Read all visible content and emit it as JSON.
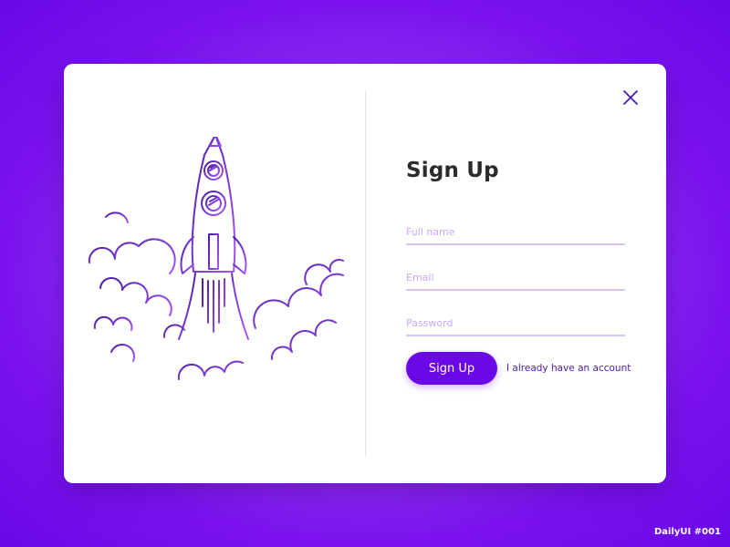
{
  "form": {
    "title": "Sign Up",
    "fields": [
      {
        "placeholder": "Full name",
        "value": ""
      },
      {
        "placeholder": "Email",
        "value": ""
      },
      {
        "placeholder": "Password",
        "value": ""
      }
    ],
    "submit_label": "Sign Up",
    "login_link": "I already have an account"
  },
  "credit": "DailyUI #001",
  "icons": {
    "close": "close-icon",
    "illustration": "rocket-icon"
  },
  "colors": {
    "background": "#7b12ee",
    "accent": "#6a08e6",
    "field_underline": "#d7c2f7",
    "placeholder": "#c9a8f3",
    "title": "#2b2b2b",
    "link": "#4a1aa8"
  }
}
